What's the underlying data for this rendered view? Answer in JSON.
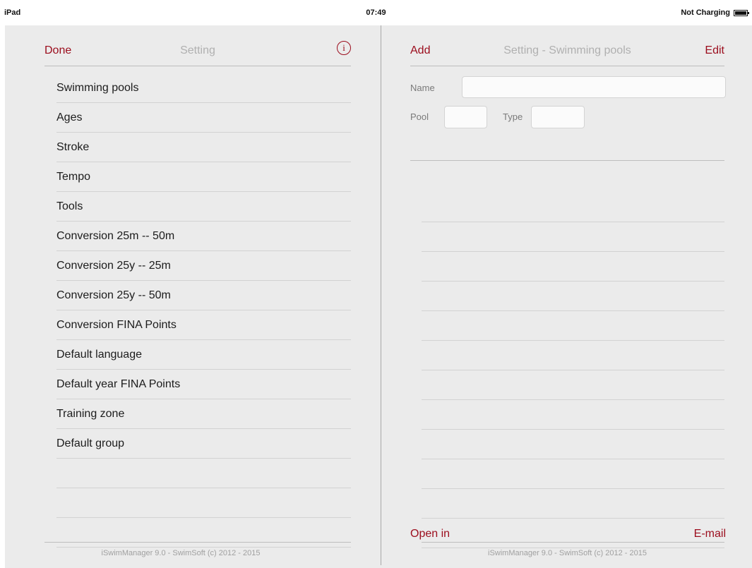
{
  "status_bar": {
    "device": "iPad",
    "time": "07:49",
    "battery": "Not Charging"
  },
  "left_panel": {
    "done_label": "Done",
    "title": "Setting",
    "info_glyph": "i",
    "items": [
      "Swimming pools",
      "Ages",
      "Stroke",
      "Tempo",
      "Tools",
      "Conversion 25m -- 50m",
      "Conversion 25y -- 25m",
      "Conversion 25y -- 50m",
      "Conversion FINA Points",
      "Default language",
      "Default year FINA Points",
      "Training zone",
      "Default group"
    ],
    "footer": "iSwimManager 9.0 - SwimSoft (c) 2012 - 2015"
  },
  "right_panel": {
    "add_label": "Add",
    "title": "Setting - Swimming pools",
    "edit_label": "Edit",
    "form": {
      "name_label": "Name",
      "name_value": "",
      "pool_label": "Pool",
      "pool_value": "",
      "type_label": "Type",
      "type_value": ""
    },
    "open_in_label": "Open in",
    "email_label": "E-mail",
    "footer": "iSwimManager 9.0 - SwimSoft (c) 2012 - 2015"
  },
  "colors": {
    "accent": "#9b0c1c",
    "background": "#ebebeb",
    "title_gray": "#b0b0b0"
  },
  "icons": {
    "info": "info-circle-icon",
    "battery": "battery-icon"
  }
}
